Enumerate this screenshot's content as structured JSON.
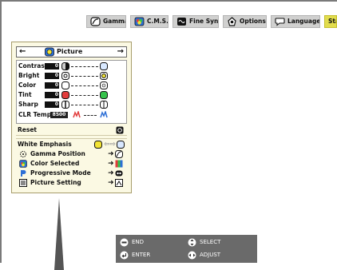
{
  "tabs": [
    {
      "label": "Gamma",
      "icon": "gamma-icon"
    },
    {
      "label": "C.M.S.",
      "icon": "cms-icon"
    },
    {
      "label": "Fine Sync",
      "icon": "fine-sync-icon"
    },
    {
      "label": "Options",
      "icon": "options-icon"
    },
    {
      "label": "Language",
      "icon": "language-icon"
    },
    {
      "label": "Stat",
      "icon": ""
    }
  ],
  "menu": {
    "title": "Picture",
    "left_arrow": "←",
    "right_arrow": "→",
    "adjustments": [
      {
        "label": "Contrast",
        "value": "0"
      },
      {
        "label": "Bright",
        "value": "0"
      },
      {
        "label": "Color",
        "value": "0"
      },
      {
        "label": "Tint",
        "value": "0"
      },
      {
        "label": "Sharp",
        "value": "0"
      },
      {
        "label": "CLR Temp",
        "value": "8500"
      }
    ],
    "reset_label": "Reset",
    "options": [
      {
        "label": "White Emphasis"
      },
      {
        "label": "Gamma Position"
      },
      {
        "label": "Color Selected"
      },
      {
        "label": "Progressive Mode"
      },
      {
        "label": "Picture Setting"
      }
    ]
  },
  "help": {
    "end": "END",
    "enter": "ENTER",
    "select": "SELECT",
    "adjust": "ADJUST"
  },
  "colors": {
    "panel_bg": "#fbf9e3",
    "tab_bg": "#d0d0cf",
    "tab_active": "#e2dd4d",
    "help_bg": "#6a6a6a"
  }
}
